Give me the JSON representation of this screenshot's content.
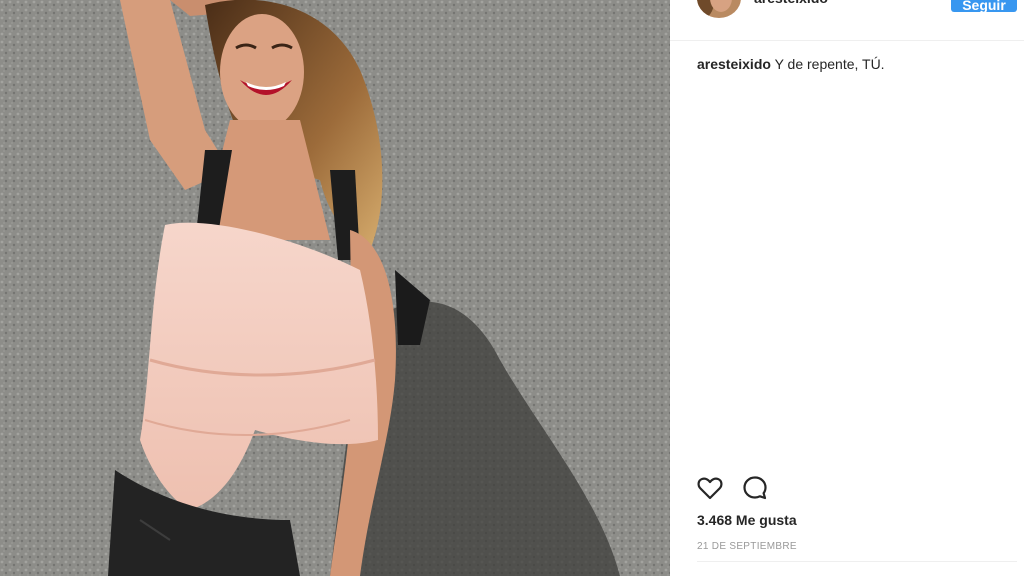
{
  "post": {
    "username": "aresteixido",
    "follow_label": "Seguir",
    "caption_user": "aresteixido",
    "caption_text": " Y de repente, TÚ.",
    "likes": "3.468 Me gusta",
    "date": "21 DE SEPTIEMBRE"
  },
  "icons": {
    "like": "heart-icon",
    "comment": "comment-icon"
  },
  "colors": {
    "accent": "#3897f0",
    "text": "#262626",
    "muted": "#999999",
    "divider": "#efefef"
  }
}
